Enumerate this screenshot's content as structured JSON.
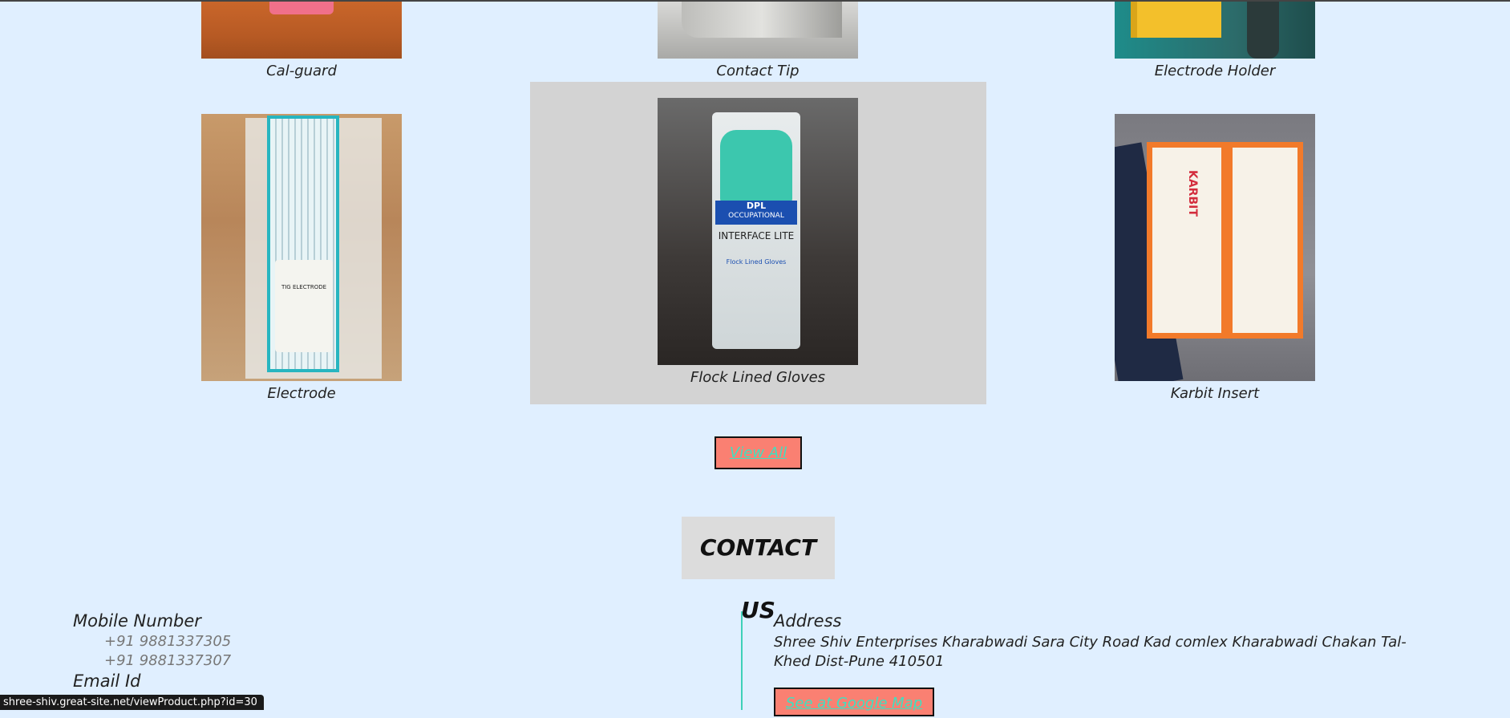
{
  "products": [
    {
      "name": "Cal-guard"
    },
    {
      "name": "Contact Tip"
    },
    {
      "name": "Electrode Holder"
    },
    {
      "name": "Electrode",
      "label_text": "TIG ELECTRODE"
    },
    {
      "name": "Flock Lined Gloves",
      "label_brand": "DPL",
      "label_sub": "OCCUPATIONAL",
      "label_title": "INTERFACE LITE",
      "label_desc": "Flock Lined Gloves"
    },
    {
      "name": "Karbit Insert",
      "label_brand": "KARBIT"
    }
  ],
  "view_all_label": "View All",
  "contact": {
    "heading": "CONTACT US",
    "mobile_label": "Mobile Number",
    "phones": [
      "+91 9881337305",
      "+91 9881337307"
    ],
    "email_label": "Email Id",
    "address_label": "Address",
    "address": "Shree Shiv Enterprises Kharabwadi Sara City Road Kad comlex Kharabwadi Chakan Tal- Khed Dist-Pune 410501",
    "map_button": "See at Google Map"
  },
  "status_url": "shree-shiv.great-site.net/viewProduct.php?id=30",
  "colors": {
    "background": "#e0efff",
    "button_bg": "#fa8072",
    "button_text": "#3fe0c0",
    "card_hover": "#d3d3d3",
    "divider": "#3fd0b8"
  }
}
